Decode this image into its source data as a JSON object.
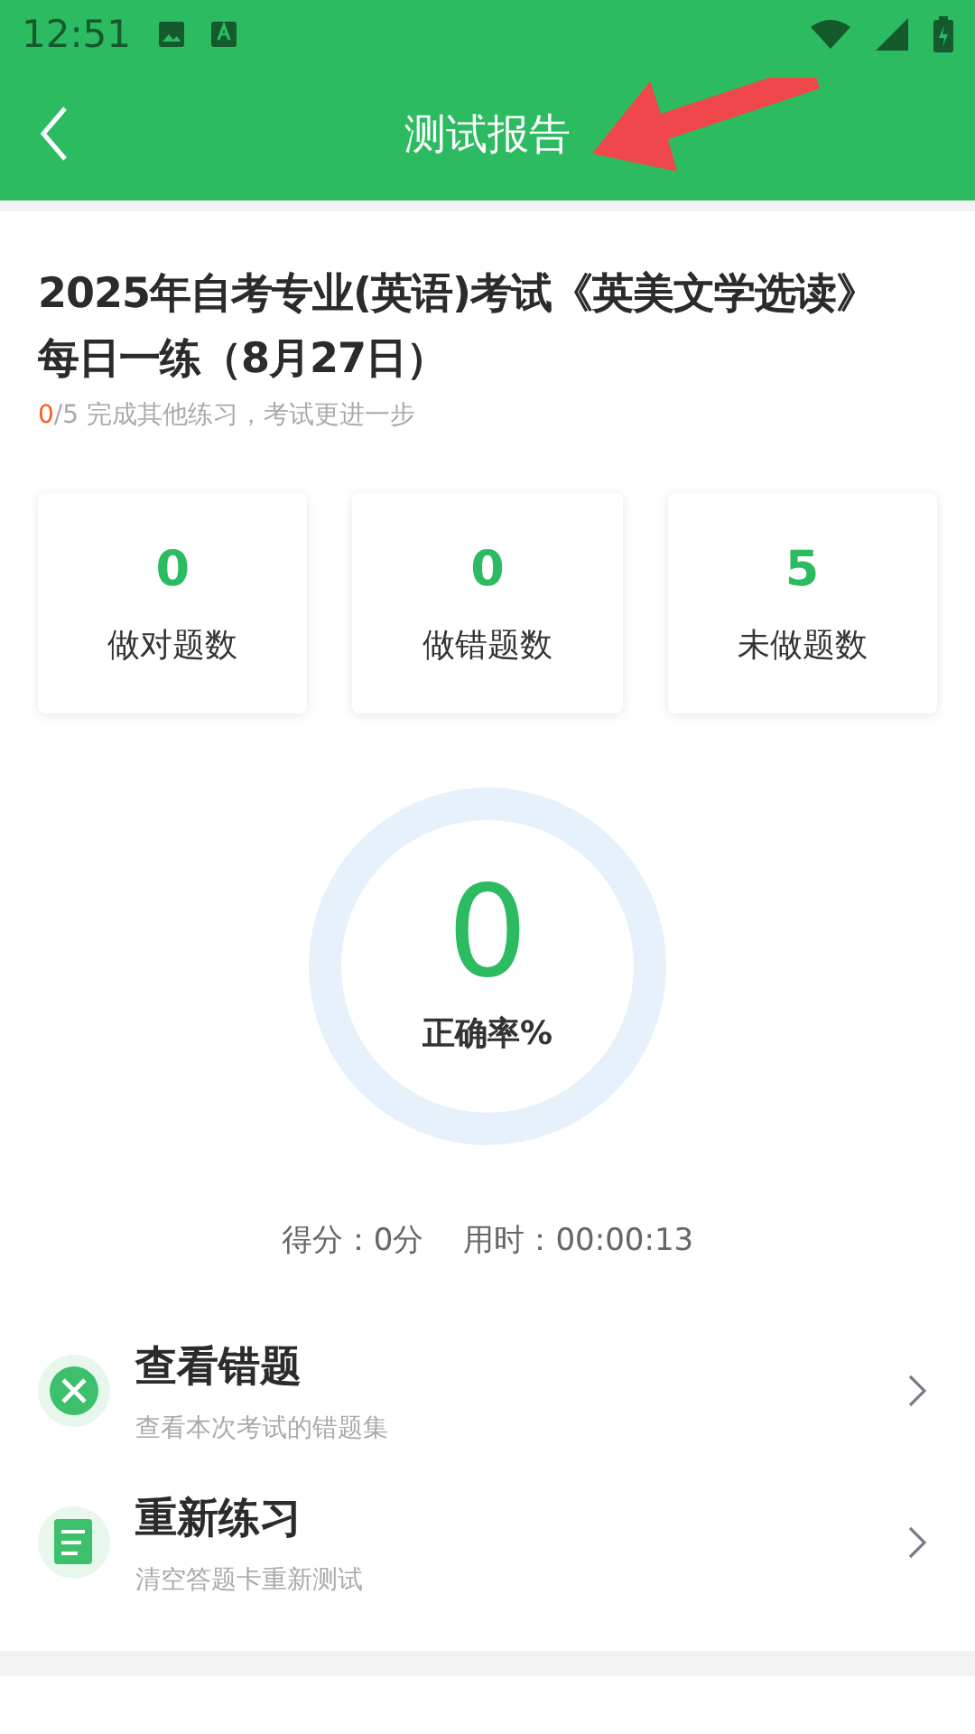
{
  "status_bar": {
    "time": "12:51"
  },
  "header": {
    "title": "测试报告"
  },
  "exam": {
    "title": "2025年自考专业(英语)考试《英美文学选读》每日一练（8月27日）",
    "done": "0",
    "progress_rest": "/5 完成其他练习，考试更进一步"
  },
  "stats": [
    {
      "value": "0",
      "label": "做对题数"
    },
    {
      "value": "0",
      "label": "做错题数"
    },
    {
      "value": "5",
      "label": "未做题数"
    }
  ],
  "accuracy": {
    "value": "0",
    "label": "正确率%"
  },
  "summary": {
    "score": "得分：0分",
    "time": "用时：00:00:13"
  },
  "actions": [
    {
      "kind": "wrong",
      "title": "查看错题",
      "subtitle": "查看本次考试的错题集"
    },
    {
      "kind": "redo",
      "title": "重新练习",
      "subtitle": "清空答题卡重新测试"
    }
  ]
}
